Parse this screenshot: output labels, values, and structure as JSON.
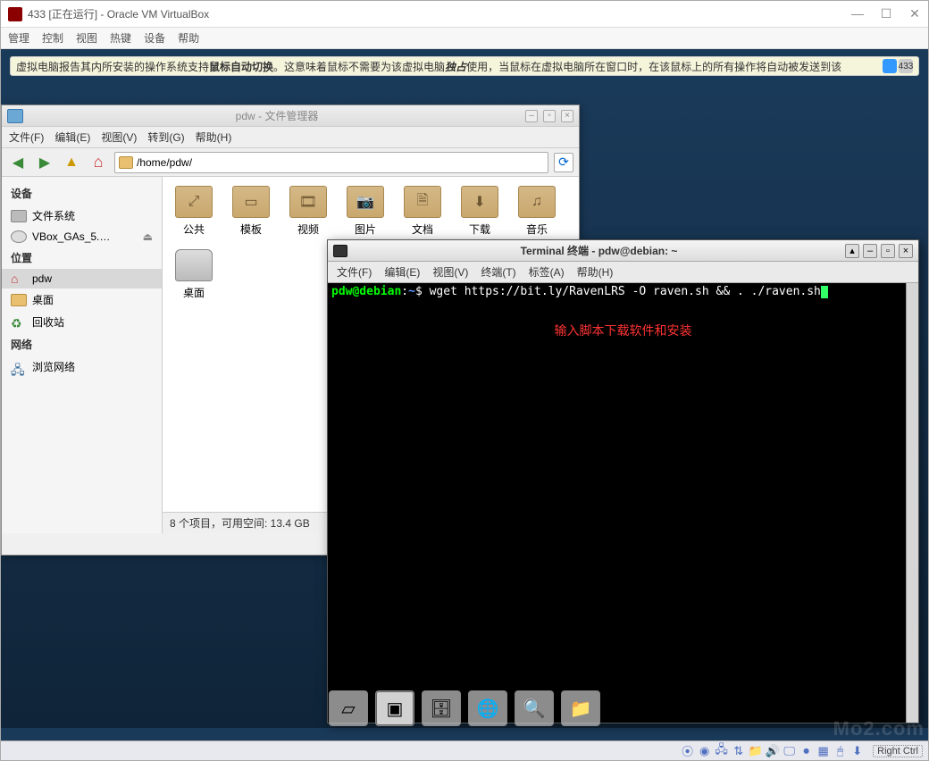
{
  "vbox": {
    "title": "433 [正在运行] - Oracle VM VirtualBox",
    "menu": {
      "control": "管理",
      "ctrl": "控制",
      "view": "视图",
      "hotkey": "热键",
      "device": "设备",
      "help": "帮助"
    },
    "info_prefix": "虚拟电脑报告其内所安装的操作系统支持 ",
    "info_bold1": "鼠标自动切换",
    "info_mid": "。这意味着鼠标不需要为该虚拟电脑 ",
    "info_italic": "独占",
    "info_suffix": " 使用，当鼠标在虚拟电脑所在窗口时，在该鼠标上的所有操作将自动被发送到该",
    "info_badge": "433",
    "hostkey": "Right Ctrl"
  },
  "fm": {
    "title": "pdw - 文件管理器",
    "menu": {
      "file": "文件(F)",
      "edit": "编辑(E)",
      "view": "视图(V)",
      "go": "转到(G)",
      "help": "帮助(H)"
    },
    "path": "/home/pdw/",
    "side": {
      "devices": "设备",
      "filesystem": "文件系统",
      "vbox_ga": "VBox_GAs_5.…",
      "places": "位置",
      "home": "pdw",
      "desktop": "桌面",
      "trash": "回收站",
      "network_h": "网络",
      "browse_net": "浏览网络"
    },
    "icons": {
      "public": "公共",
      "templates": "模板",
      "video": "视频",
      "pictures": "图片",
      "documents": "文档",
      "downloads": "下载",
      "music": "音乐",
      "desktop": "桌面"
    },
    "status": "8 个项目，可用空间: 13.4 GB"
  },
  "term": {
    "title": "Terminal 终端 - pdw@debian: ~",
    "menu": {
      "file": "文件(F)",
      "edit": "编辑(E)",
      "view": "视图(V)",
      "terminal": "终端(T)",
      "tabs": "标签(A)",
      "help": "帮助(H)"
    },
    "prompt_user": "pdw@debian",
    "prompt_colon": ":",
    "prompt_path": "~",
    "prompt_dollar": "$ ",
    "command": "wget https://bit.ly/RavenLRS -O raven.sh && . ./raven.sh",
    "note": "输入脚本下载软件和安装"
  },
  "watermark": "Mo2.com"
}
